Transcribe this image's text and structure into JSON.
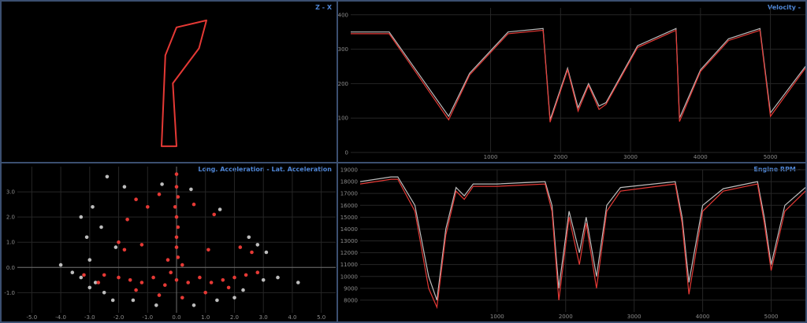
{
  "panels": {
    "zx": {
      "title": "Z - X"
    },
    "velocity": {
      "title": "Velocity - "
    },
    "accel": {
      "title": "Long. Acceleration - Lat. Acceleration"
    },
    "rpm": {
      "title": "Engine RPM - "
    }
  },
  "colors": {
    "series_a": "#e53935",
    "series_b": "#bdbdbd",
    "grid": "#262626",
    "panel_border": "#3b4f70",
    "title": "#4f86d6"
  },
  "chart_data": [
    {
      "type": "line",
      "panel": "zx",
      "title": "Z - X",
      "xlabel": "",
      "ylabel": "",
      "grid": false,
      "track": [
        [
          0.55,
          0.95
        ],
        [
          0.4,
          0.95
        ],
        [
          0.45,
          0.3
        ],
        [
          0.6,
          0.1
        ],
        [
          1.0,
          0.05
        ],
        [
          0.9,
          0.25
        ],
        [
          0.55,
          0.5
        ],
        [
          0.6,
          0.95
        ]
      ]
    },
    {
      "type": "line",
      "panel": "velocity",
      "title": "Velocity - ",
      "xlabel": "",
      "ylabel": "",
      "grid": true,
      "xlim": [
        -1000,
        5500
      ],
      "ylim": [
        0,
        420
      ],
      "x_ticks": [
        1000,
        2000,
        3000,
        4000,
        5000
      ],
      "y_ticks": [
        0,
        100,
        200,
        300,
        400
      ],
      "series": [
        {
          "color": "#bdbdbd",
          "points": [
            [
              -1000,
              350
            ],
            [
              -450,
              350
            ],
            [
              400,
              105
            ],
            [
              700,
              230
            ],
            [
              1250,
              350
            ],
            [
              1750,
              360
            ],
            [
              1850,
              95
            ],
            [
              2100,
              245
            ],
            [
              2250,
              130
            ],
            [
              2400,
              200
            ],
            [
              2550,
              135
            ],
            [
              2650,
              145
            ],
            [
              3100,
              310
            ],
            [
              3650,
              360
            ],
            [
              3700,
              100
            ],
            [
              4000,
              240
            ],
            [
              4400,
              330
            ],
            [
              4850,
              360
            ],
            [
              5000,
              115
            ],
            [
              5500,
              250
            ]
          ]
        },
        {
          "color": "#e53935",
          "points": [
            [
              -1000,
              345
            ],
            [
              -450,
              345
            ],
            [
              400,
              95
            ],
            [
              700,
              225
            ],
            [
              1250,
              345
            ],
            [
              1750,
              355
            ],
            [
              1850,
              88
            ],
            [
              2100,
              240
            ],
            [
              2250,
              120
            ],
            [
              2400,
              195
            ],
            [
              2550,
              125
            ],
            [
              2650,
              140
            ],
            [
              3100,
              305
            ],
            [
              3650,
              355
            ],
            [
              3700,
              90
            ],
            [
              4000,
              235
            ],
            [
              4400,
              325
            ],
            [
              4850,
              355
            ],
            [
              5000,
              105
            ],
            [
              5500,
              245
            ]
          ]
        }
      ]
    },
    {
      "type": "scatter",
      "panel": "accel",
      "title": "Long. Acceleration - Lat. Acceleration",
      "xlabel": "",
      "ylabel": "",
      "grid": true,
      "xlim": [
        -5.5,
        5.5
      ],
      "ylim": [
        -1.8,
        4.0
      ],
      "x_ticks": [
        -5.0,
        -4.0,
        -3.0,
        -2.0,
        -1.0,
        0.0,
        1.0,
        2.0,
        3.0,
        4.0,
        5.0
      ],
      "y_ticks": [
        -1.0,
        0.0,
        1.0,
        2.0,
        3.0
      ],
      "series": [
        {
          "color": "#bdbdbd",
          "points": [
            [
              -3.3,
              -0.4
            ],
            [
              -3.0,
              -0.8
            ],
            [
              -2.8,
              -0.6
            ],
            [
              -2.5,
              -1.0
            ],
            [
              -3.1,
              1.2
            ],
            [
              -2.6,
              1.6
            ],
            [
              -2.9,
              2.4
            ],
            [
              -2.4,
              3.6
            ],
            [
              -1.8,
              3.2
            ],
            [
              -3.3,
              2.0
            ],
            [
              -2.1,
              0.8
            ],
            [
              -1.5,
              -1.3
            ],
            [
              -0.7,
              -1.5
            ],
            [
              0.6,
              -1.5
            ],
            [
              1.4,
              -1.3
            ],
            [
              2.3,
              -0.9
            ],
            [
              3.0,
              -0.5
            ],
            [
              3.5,
              -0.4
            ],
            [
              4.2,
              -0.6
            ],
            [
              2.8,
              0.9
            ],
            [
              3.1,
              0.6
            ],
            [
              2.5,
              1.2
            ],
            [
              -4.0,
              0.1
            ],
            [
              -3.6,
              -0.2
            ],
            [
              0.5,
              3.1
            ],
            [
              -0.5,
              3.3
            ],
            [
              1.5,
              2.3
            ],
            [
              -3.0,
              0.3
            ],
            [
              2.0,
              -1.2
            ],
            [
              -2.2,
              -1.3
            ]
          ]
        },
        {
          "color": "#e53935",
          "points": [
            [
              0.0,
              3.7
            ],
            [
              0.0,
              3.2
            ],
            [
              0.05,
              2.8
            ],
            [
              -0.05,
              2.4
            ],
            [
              0.0,
              2.0
            ],
            [
              0.05,
              1.6
            ],
            [
              0.0,
              1.2
            ],
            [
              0.0,
              0.8
            ],
            [
              0.05,
              0.4
            ],
            [
              -1.4,
              2.7
            ],
            [
              -1.0,
              2.4
            ],
            [
              -0.6,
              2.9
            ],
            [
              0.6,
              2.5
            ],
            [
              1.3,
              2.1
            ],
            [
              -1.7,
              1.9
            ],
            [
              -2.0,
              1.0
            ],
            [
              -1.8,
              0.7
            ],
            [
              -1.2,
              0.9
            ],
            [
              1.1,
              0.7
            ],
            [
              2.2,
              0.8
            ],
            [
              2.6,
              0.6
            ],
            [
              -2.5,
              -0.3
            ],
            [
              -2.0,
              -0.4
            ],
            [
              -1.6,
              -0.5
            ],
            [
              -1.2,
              -0.6
            ],
            [
              -0.8,
              -0.4
            ],
            [
              -0.4,
              -0.7
            ],
            [
              0.0,
              -0.5
            ],
            [
              0.4,
              -0.6
            ],
            [
              0.8,
              -0.4
            ],
            [
              1.2,
              -0.6
            ],
            [
              1.6,
              -0.5
            ],
            [
              2.0,
              -0.4
            ],
            [
              2.4,
              -0.3
            ],
            [
              -3.2,
              -0.3
            ],
            [
              -2.7,
              -0.6
            ],
            [
              -1.4,
              -0.9
            ],
            [
              -0.6,
              -1.1
            ],
            [
              0.2,
              -1.2
            ],
            [
              1.0,
              -1.0
            ],
            [
              1.8,
              -0.8
            ],
            [
              2.8,
              -0.2
            ],
            [
              -0.2,
              -0.2
            ],
            [
              0.2,
              0.1
            ],
            [
              -0.3,
              0.3
            ]
          ]
        }
      ]
    },
    {
      "type": "line",
      "panel": "rpm",
      "title": "Engine RPM - ",
      "xlabel": "",
      "ylabel": "",
      "grid": true,
      "xlim": [
        -1000,
        5500
      ],
      "ylim": [
        7000,
        19000
      ],
      "x_ticks": [
        1000,
        2000,
        3000,
        4000,
        5000
      ],
      "y_ticks": [
        8000,
        9000,
        10000,
        11000,
        12000,
        13000,
        14000,
        15000,
        16000,
        17000,
        18000,
        19000
      ],
      "series": [
        {
          "color": "#bdbdbd",
          "points": [
            [
              -1000,
              18000
            ],
            [
              -550,
              18400
            ],
            [
              -450,
              18400
            ],
            [
              -200,
              16000
            ],
            [
              0,
              10000
            ],
            [
              120,
              8000
            ],
            [
              250,
              14000
            ],
            [
              400,
              17500
            ],
            [
              520,
              16800
            ],
            [
              650,
              17800
            ],
            [
              1000,
              17800
            ],
            [
              1700,
              18000
            ],
            [
              1800,
              16000
            ],
            [
              1900,
              9000
            ],
            [
              2050,
              15500
            ],
            [
              2200,
              12000
            ],
            [
              2300,
              15000
            ],
            [
              2450,
              10000
            ],
            [
              2600,
              16000
            ],
            [
              2800,
              17500
            ],
            [
              3600,
              18000
            ],
            [
              3700,
              15000
            ],
            [
              3800,
              9500
            ],
            [
              4000,
              16000
            ],
            [
              4300,
              17400
            ],
            [
              4800,
              18000
            ],
            [
              4900,
              15000
            ],
            [
              5000,
              11000
            ],
            [
              5200,
              16000
            ],
            [
              5500,
              17500
            ]
          ]
        },
        {
          "color": "#e53935",
          "points": [
            [
              -1000,
              17800
            ],
            [
              -550,
              18200
            ],
            [
              -450,
              18200
            ],
            [
              -200,
              15500
            ],
            [
              0,
              9000
            ],
            [
              120,
              7400
            ],
            [
              250,
              13500
            ],
            [
              400,
              17200
            ],
            [
              520,
              16500
            ],
            [
              650,
              17600
            ],
            [
              1000,
              17600
            ],
            [
              1700,
              17800
            ],
            [
              1800,
              15500
            ],
            [
              1900,
              8000
            ],
            [
              2050,
              15000
            ],
            [
              2200,
              11000
            ],
            [
              2300,
              14500
            ],
            [
              2450,
              9000
            ],
            [
              2600,
              15500
            ],
            [
              2800,
              17200
            ],
            [
              3600,
              17800
            ],
            [
              3700,
              14500
            ],
            [
              3800,
              8500
            ],
            [
              4000,
              15500
            ],
            [
              4300,
              17200
            ],
            [
              4800,
              17800
            ],
            [
              4900,
              14500
            ],
            [
              5000,
              10500
            ],
            [
              5200,
              15500
            ],
            [
              5500,
              17200
            ]
          ]
        }
      ]
    }
  ]
}
